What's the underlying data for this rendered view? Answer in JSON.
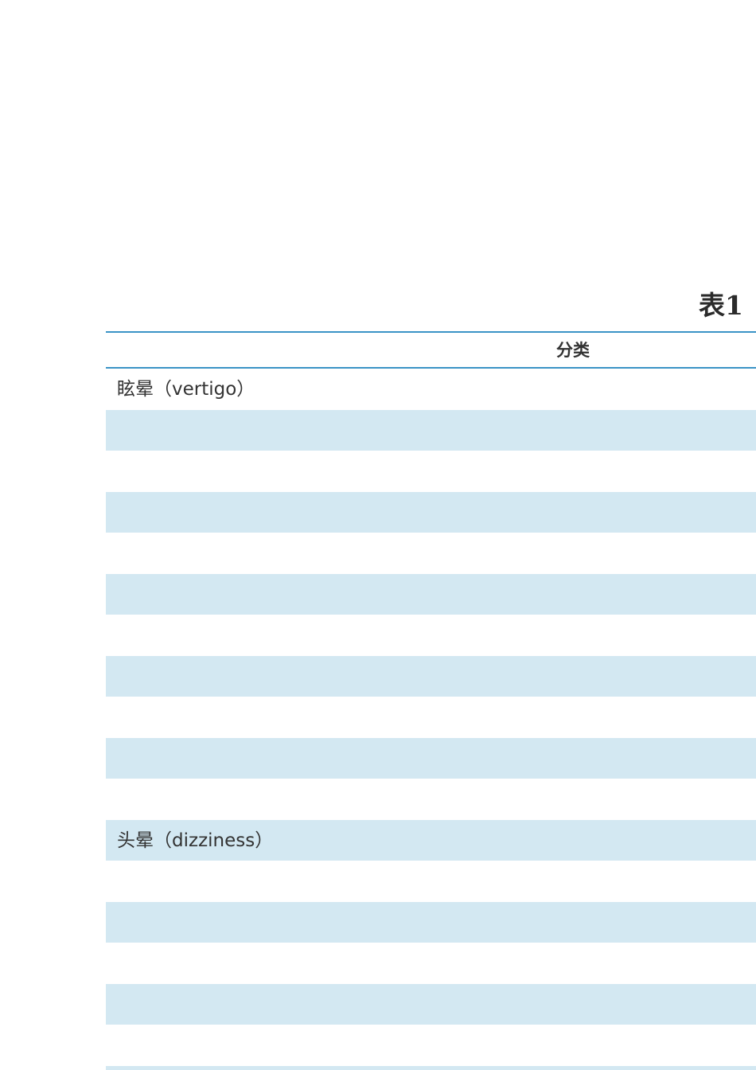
{
  "title": "表1",
  "table": {
    "header": {
      "category": "分类"
    },
    "rows": [
      {
        "label": "眩晕（vertigo）",
        "shaded": false
      },
      {
        "label": "",
        "shaded": true
      },
      {
        "label": "",
        "shaded": false
      },
      {
        "label": "",
        "shaded": true
      },
      {
        "label": "",
        "shaded": false
      },
      {
        "label": "",
        "shaded": true
      },
      {
        "label": "",
        "shaded": false
      },
      {
        "label": "",
        "shaded": true
      },
      {
        "label": "",
        "shaded": false
      },
      {
        "label": "",
        "shaded": true
      },
      {
        "label": "",
        "shaded": false
      },
      {
        "label": "头晕（dizziness）",
        "shaded": true
      },
      {
        "label": "",
        "shaded": false
      },
      {
        "label": "",
        "shaded": true
      },
      {
        "label": "",
        "shaded": false
      },
      {
        "label": "",
        "shaded": true
      },
      {
        "label": "",
        "shaded": false
      },
      {
        "label": "",
        "shaded": true
      }
    ]
  },
  "colors": {
    "rule": "#3a93c6",
    "shade": "#d3e8f2"
  }
}
